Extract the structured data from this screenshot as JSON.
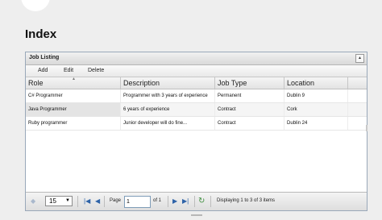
{
  "page": {
    "title": "Index"
  },
  "grid": {
    "title": "Job Listing",
    "collapse_icon": "triangle-up-icon",
    "toolbar": {
      "add": "Add",
      "edit": "Edit",
      "delete": "Delete"
    },
    "columns": [
      "Role",
      "Description",
      "Job Type",
      "Location"
    ],
    "rows": [
      {
        "role": "C# Programmer",
        "description": "Programmer with 3 years of experience",
        "job_type": "Permanent",
        "location": "Dublin 9"
      },
      {
        "role": "Java Programmer",
        "description": "6 years of experience",
        "job_type": "Contract",
        "location": "Cork"
      },
      {
        "role": "Ruby programmer",
        "description": "Junior developer will do fine...",
        "job_type": "Contract",
        "location": "Dublin 24"
      }
    ]
  },
  "pager": {
    "page_size": "15",
    "page_label": "Page",
    "page_value": "1",
    "of_label": "of 1",
    "status": "Displaying 1 to 3 of 3 items"
  }
}
